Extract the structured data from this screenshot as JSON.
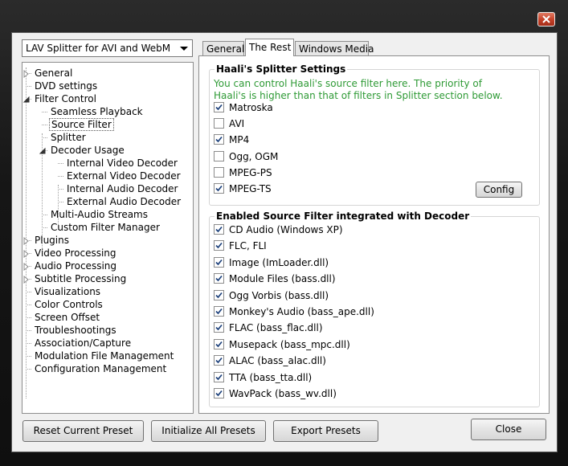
{
  "window": {
    "close_title": "Close window"
  },
  "preset_dropdown": {
    "value": "LAV Splitter for AVI and WebM"
  },
  "tree": [
    {
      "label": "General",
      "level": 0,
      "expander": "collapsed"
    },
    {
      "label": "DVD settings",
      "level": 0,
      "expander": "none"
    },
    {
      "label": "Filter Control",
      "level": 0,
      "expander": "expanded"
    },
    {
      "label": "Seamless Playback",
      "level": 1,
      "expander": "none"
    },
    {
      "label": "Source Filter",
      "level": 1,
      "expander": "none",
      "selected": true
    },
    {
      "label": "Splitter",
      "level": 1,
      "expander": "none"
    },
    {
      "label": "Decoder Usage",
      "level": 1,
      "expander": "expanded"
    },
    {
      "label": "Internal Video Decoder",
      "level": 2,
      "expander": "none"
    },
    {
      "label": "External Video Decoder",
      "level": 2,
      "expander": "none"
    },
    {
      "label": "Internal Audio Decoder",
      "level": 2,
      "expander": "none"
    },
    {
      "label": "External Audio Decoder",
      "level": 2,
      "expander": "none"
    },
    {
      "label": "Multi-Audio Streams",
      "level": 1,
      "expander": "none"
    },
    {
      "label": "Custom Filter Manager",
      "level": 1,
      "expander": "none"
    },
    {
      "label": "Plugins",
      "level": 0,
      "expander": "collapsed"
    },
    {
      "label": "Video Processing",
      "level": 0,
      "expander": "collapsed"
    },
    {
      "label": "Audio Processing",
      "level": 0,
      "expander": "collapsed"
    },
    {
      "label": "Subtitle Processing",
      "level": 0,
      "expander": "collapsed"
    },
    {
      "label": "Visualizations",
      "level": 0,
      "expander": "none"
    },
    {
      "label": "Color Controls",
      "level": 0,
      "expander": "none"
    },
    {
      "label": "Screen Offset",
      "level": 0,
      "expander": "none"
    },
    {
      "label": "Troubleshootings",
      "level": 0,
      "expander": "none"
    },
    {
      "label": "Association/Capture",
      "level": 0,
      "expander": "none"
    },
    {
      "label": "Modulation File Management",
      "level": 0,
      "expander": "none"
    },
    {
      "label": "Configuration Management",
      "level": 0,
      "expander": "none"
    }
  ],
  "tabs": [
    {
      "label": "General",
      "active": false
    },
    {
      "label": "The Rest",
      "active": true
    },
    {
      "label": "Windows Media",
      "active": false
    }
  ],
  "haali": {
    "title": "Haali's Splitter Settings",
    "note_line1": "You can control Haali's source filter here. The priority of",
    "note_line2": "Haali's is higher than that of filters in Splitter section below.",
    "items": [
      {
        "label": "Matroska",
        "checked": true
      },
      {
        "label": "AVI",
        "checked": false
      },
      {
        "label": "MP4",
        "checked": true
      },
      {
        "label": "Ogg, OGM",
        "checked": false
      },
      {
        "label": "MPEG-PS",
        "checked": false
      },
      {
        "label": "MPEG-TS",
        "checked": true
      }
    ],
    "config_label": "Config"
  },
  "source_filters": {
    "title": "Enabled Source Filter integrated with Decoder",
    "items": [
      {
        "label": "CD Audio (Windows XP)",
        "checked": true
      },
      {
        "label": "FLC, FLI",
        "checked": true
      },
      {
        "label": "Image (ImLoader.dll)",
        "checked": true
      },
      {
        "label": "Module Files (bass.dll)",
        "checked": true
      },
      {
        "label": "Ogg Vorbis (bass.dll)",
        "checked": true
      },
      {
        "label": "Monkey's Audio (bass_ape.dll)",
        "checked": true
      },
      {
        "label": "FLAC (bass_flac.dll)",
        "checked": true
      },
      {
        "label": "Musepack (bass_mpc.dll)",
        "checked": true
      },
      {
        "label": "ALAC (bass_alac.dll)",
        "checked": true
      },
      {
        "label": "TTA (bass_tta.dll)",
        "checked": true
      },
      {
        "label": "WavPack (bass_wv.dll)",
        "checked": true
      }
    ]
  },
  "footer": {
    "reset_label": "Reset Current Preset",
    "init_label": "Initialize All Presets",
    "export_label": "Export Presets",
    "close_label": "Close"
  },
  "colors": {
    "note": "#2e9a35",
    "close_button": "#c7432a",
    "frame": "#161616"
  }
}
